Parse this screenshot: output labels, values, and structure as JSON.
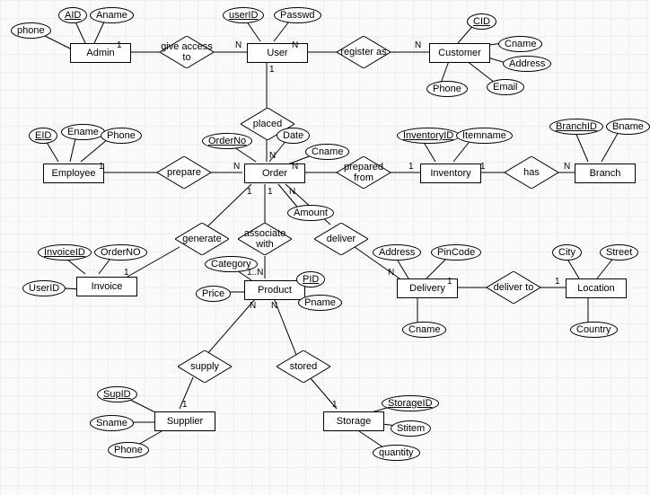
{
  "entities": {
    "admin": "Admin",
    "user": "User",
    "customer": "Customer",
    "employee": "Employee",
    "order": "Order",
    "inventory": "Inventory",
    "branch": "Branch",
    "invoice": "Invoice",
    "product": "Product",
    "delivery": "Delivery",
    "location": "Location",
    "supplier": "Supplier",
    "storage": "Storage"
  },
  "attrs": {
    "aid": "AID",
    "aname": "Aname",
    "phone_admin": "phone",
    "userid": "userID",
    "passwd": "Passwd",
    "cid": "CID",
    "cname_cust": "Cname",
    "address_cust": "Address",
    "email": "Email",
    "phone_cust": "Phone",
    "eid": "EID",
    "ename": "Ename",
    "phone_emp": "Phone",
    "orderno": "OrderNo",
    "date": "Date",
    "cname_order": "Cname",
    "amount": "Amount",
    "inventoryid": "InventoryID",
    "itemname": "Itemname",
    "branchid": "BranchID",
    "bname": "Bname",
    "invoiceid": "InvoiceID",
    "orderno_inv": "OrderNO",
    "userid_inv": "UserID",
    "category": "Category",
    "price": "Price",
    "pid": "PID",
    "pname": "Pname",
    "address_del": "Address",
    "pincode": "PinCode",
    "cname_del": "Cname",
    "city": "City",
    "street": "Street",
    "country": "Country",
    "supid": "SupID",
    "sname": "Sname",
    "phone_sup": "Phone",
    "storageid": "StorageID",
    "stitem": "Stitem",
    "quantity": "quantity"
  },
  "rels": {
    "give_access": "give access to",
    "register_as": "register as",
    "placed": "placed",
    "prepare": "prepare",
    "prepared_from": "prepared from",
    "has": "has",
    "generate": "generate",
    "associate": "associate with",
    "deliver": "deliver",
    "deliver_to": "deliver to",
    "supply": "supply",
    "stored": "stored"
  },
  "card": {
    "1": "1",
    "N": "N",
    "1N": "1..N"
  },
  "chart_data": {
    "type": "ER-diagram",
    "entities": [
      {
        "name": "Admin",
        "attributes": [
          {
            "name": "AID",
            "key": true
          },
          {
            "name": "Aname"
          },
          {
            "name": "phone"
          }
        ]
      },
      {
        "name": "User",
        "attributes": [
          {
            "name": "userID",
            "key": true
          },
          {
            "name": "Passwd"
          }
        ]
      },
      {
        "name": "Customer",
        "attributes": [
          {
            "name": "CID",
            "key": true
          },
          {
            "name": "Cname"
          },
          {
            "name": "Address"
          },
          {
            "name": "Email"
          },
          {
            "name": "Phone"
          }
        ]
      },
      {
        "name": "Employee",
        "attributes": [
          {
            "name": "EID",
            "key": true
          },
          {
            "name": "Ename"
          },
          {
            "name": "Phone"
          }
        ]
      },
      {
        "name": "Order",
        "attributes": [
          {
            "name": "OrderNo",
            "key": true
          },
          {
            "name": "Date"
          },
          {
            "name": "Cname"
          },
          {
            "name": "Amount"
          }
        ]
      },
      {
        "name": "Inventory",
        "attributes": [
          {
            "name": "InventoryID",
            "key": true
          },
          {
            "name": "Itemname"
          }
        ]
      },
      {
        "name": "Branch",
        "attributes": [
          {
            "name": "BranchID",
            "key": true
          },
          {
            "name": "Bname"
          }
        ]
      },
      {
        "name": "Invoice",
        "attributes": [
          {
            "name": "InvoiceID",
            "key": true
          },
          {
            "name": "OrderNO"
          },
          {
            "name": "UserID"
          }
        ]
      },
      {
        "name": "Product",
        "attributes": [
          {
            "name": "PID",
            "key": true
          },
          {
            "name": "Category"
          },
          {
            "name": "Price"
          },
          {
            "name": "Pname"
          }
        ]
      },
      {
        "name": "Delivery",
        "attributes": [
          {
            "name": "Address"
          },
          {
            "name": "PinCode"
          },
          {
            "name": "Cname"
          }
        ]
      },
      {
        "name": "Location",
        "attributes": [
          {
            "name": "City"
          },
          {
            "name": "Street"
          },
          {
            "name": "Country"
          }
        ]
      },
      {
        "name": "Supplier",
        "attributes": [
          {
            "name": "SupID",
            "key": true
          },
          {
            "name": "Sname"
          },
          {
            "name": "Phone"
          }
        ]
      },
      {
        "name": "Storage",
        "attributes": [
          {
            "name": "StorageID",
            "key": true
          },
          {
            "name": "Stitem"
          },
          {
            "name": "quantity"
          }
        ]
      }
    ],
    "relationships": [
      {
        "name": "give access to",
        "left": "Admin",
        "leftCard": "1",
        "right": "User",
        "rightCard": "N"
      },
      {
        "name": "register as",
        "left": "User",
        "leftCard": "N",
        "right": "Customer",
        "rightCard": "N"
      },
      {
        "name": "placed",
        "left": "User",
        "leftCard": "1",
        "right": "Order",
        "rightCard": "N"
      },
      {
        "name": "prepare",
        "left": "Employee",
        "leftCard": "1",
        "right": "Order",
        "rightCard": "N"
      },
      {
        "name": "prepared from",
        "left": "Order",
        "leftCard": "N",
        "right": "Inventory",
        "rightCard": "1"
      },
      {
        "name": "has",
        "left": "Inventory",
        "leftCard": "1",
        "right": "Branch",
        "rightCard": "N"
      },
      {
        "name": "generate",
        "left": "Order",
        "leftCard": "1",
        "right": "Invoice",
        "rightCard": "1"
      },
      {
        "name": "associate with",
        "left": "Order",
        "leftCard": "1",
        "right": "Product",
        "rightCard": "1..N"
      },
      {
        "name": "deliver",
        "left": "Order",
        "leftCard": "N",
        "right": "Delivery",
        "rightCard": "N"
      },
      {
        "name": "deliver to",
        "left": "Delivery",
        "leftCard": "1",
        "right": "Location",
        "rightCard": "1"
      },
      {
        "name": "supply",
        "left": "Product",
        "leftCard": "N",
        "right": "Supplier",
        "rightCard": "1"
      },
      {
        "name": "stored",
        "left": "Product",
        "leftCard": "N",
        "right": "Storage",
        "rightCard": "1"
      }
    ]
  }
}
